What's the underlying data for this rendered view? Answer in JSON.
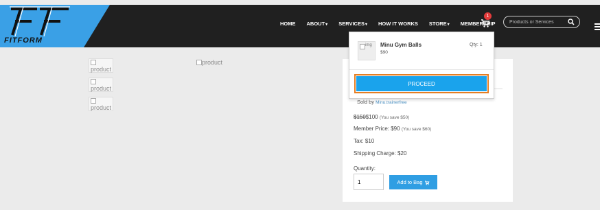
{
  "header": {
    "logo_text": "FITFORM",
    "menu": [
      {
        "label": "HOME",
        "has_caret": false
      },
      {
        "label": "ABOUT",
        "has_caret": true
      },
      {
        "label": "SERVICES",
        "has_caret": true
      },
      {
        "label": "HOW IT WORKS",
        "has_caret": false
      },
      {
        "label": "STORE",
        "has_caret": true
      },
      {
        "label": "MEMBERSHIP",
        "has_caret": false
      }
    ],
    "cart_count": "1",
    "search_placeholder": "Products or Services",
    "icons": [
      "cart-icon",
      "search-icon",
      "hamburger-menu-icon"
    ]
  },
  "gallery": {
    "thumbs": [
      "product",
      "product",
      "product"
    ],
    "main_alt": "product"
  },
  "product": {
    "sold_by_label": "Sold by",
    "seller": "Minu.trainerfree",
    "price_old": "$150",
    "price_new": "$100",
    "price_save": "(You save $50)",
    "member_label": "Member Price: $90",
    "member_save": "(You save $60)",
    "tax": "Tax: $10",
    "shipping": "Shipping Charge: $20",
    "quantity_label": "Quantity:",
    "quantity_value": "1",
    "add_button": "Add to Bag"
  },
  "cart_dropdown": {
    "item_img_alt": "img",
    "item_name": "Minu Gym Balls",
    "item_price": "$90",
    "item_qty": "Qty: 1",
    "proceed_label": "PROCEED"
  },
  "colors": {
    "nav_bg": "#202020",
    "logo_accent": "#3aa0e6",
    "button_blue": "#1aa3ec",
    "proceed_outline": "#e67e22",
    "badge_red": "#e23b3b"
  }
}
